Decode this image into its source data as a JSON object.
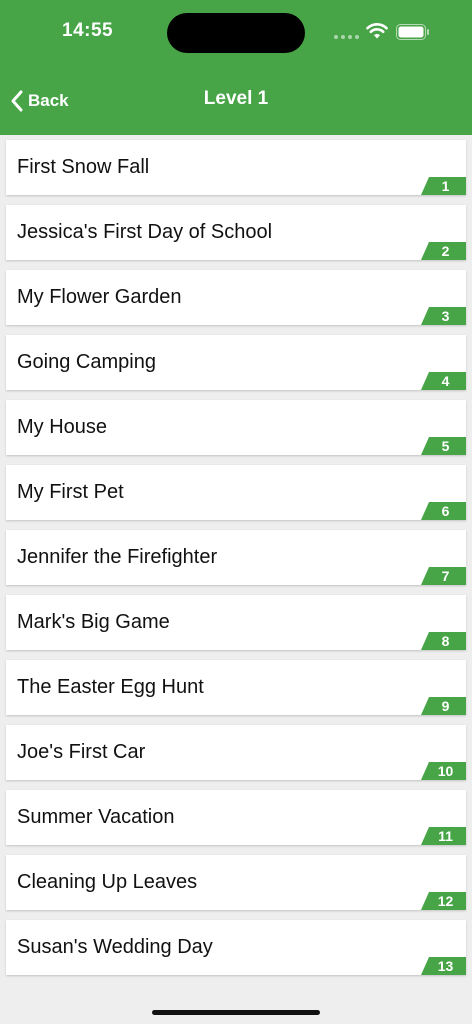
{
  "status_bar": {
    "time": "14:55"
  },
  "nav": {
    "back_label": "Back",
    "title": "Level 1"
  },
  "colors": {
    "accent": "#47a447"
  },
  "items": [
    {
      "title": "First Snow Fall",
      "number": "1"
    },
    {
      "title": "Jessica's First Day of School",
      "number": "2"
    },
    {
      "title": "My Flower Garden",
      "number": "3"
    },
    {
      "title": "Going Camping",
      "number": "4"
    },
    {
      "title": "My House",
      "number": "5"
    },
    {
      "title": "My First Pet",
      "number": "6"
    },
    {
      "title": "Jennifer the Firefighter",
      "number": "7"
    },
    {
      "title": "Mark's Big Game",
      "number": "8"
    },
    {
      "title": "The Easter Egg Hunt",
      "number": "9"
    },
    {
      "title": "Joe's First Car",
      "number": "10"
    },
    {
      "title": "Summer Vacation",
      "number": "11"
    },
    {
      "title": "Cleaning Up Leaves",
      "number": "12"
    },
    {
      "title": "Susan's Wedding Day",
      "number": "13"
    }
  ]
}
